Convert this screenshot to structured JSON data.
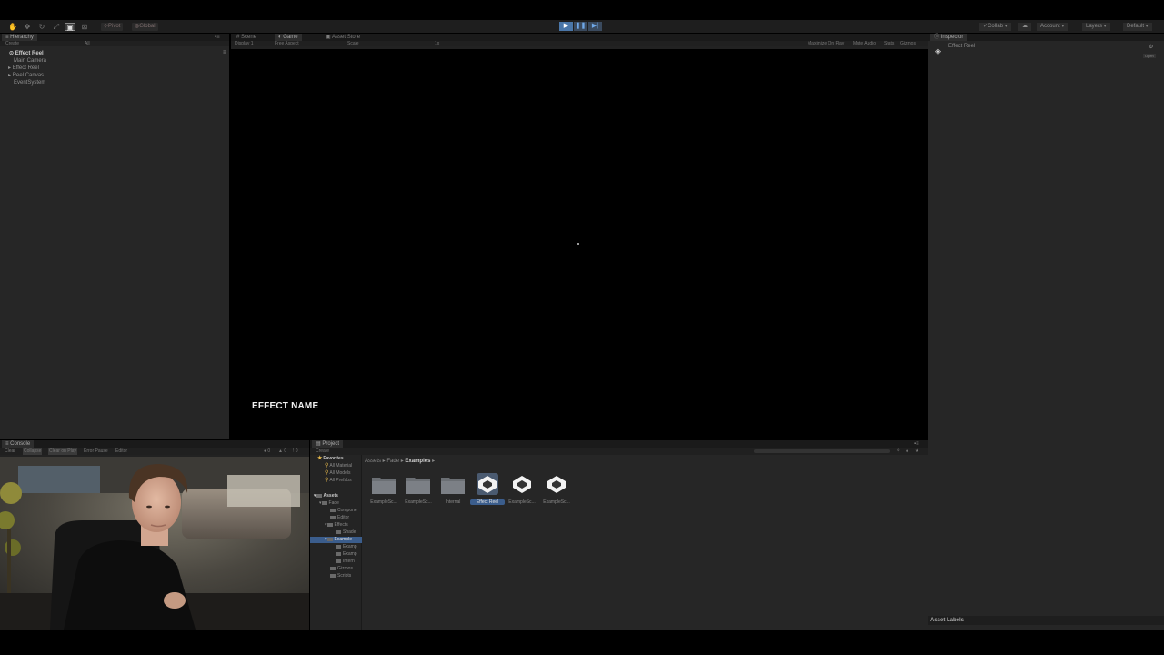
{
  "toolbar": {
    "pivot_label": "Pivot",
    "global_label": "Global",
    "collab_label": "Collab",
    "account_label": "Account",
    "layers_label": "Layers",
    "layout_label": "Default"
  },
  "hierarchy": {
    "tab_label": "Hierarchy",
    "create_label": "Create",
    "search_text": "All",
    "scene_name": "Effect Reel",
    "items": [
      "Main Camera",
      "Effect Reel",
      "Reel Canvas",
      "EventSystem"
    ]
  },
  "center": {
    "tabs": [
      "Scene",
      "Game",
      "Asset Store"
    ],
    "display_label": "Display 1",
    "aspect_label": "Free Aspect",
    "scale_label": "Scale",
    "scale_value": "1x",
    "toggles": [
      "Maximize On Play",
      "Mute Audio",
      "Stats",
      "Gizmos"
    ],
    "game_text": "EFFECT NAME"
  },
  "inspector": {
    "tab_label": "Inspector",
    "object_name": "Effect Reel",
    "open_label": "Open",
    "asset_labels_label": "Asset Labels"
  },
  "console": {
    "tab_label": "Console",
    "buttons": [
      "Clear",
      "Collapse",
      "Clear on Play",
      "Error Pause",
      "Editor"
    ],
    "counts": [
      "0",
      "0",
      "0"
    ]
  },
  "project": {
    "tab_label": "Project",
    "create_label": "Create",
    "favorites_label": "Favorites",
    "favorites": [
      "All Material",
      "All Models",
      "All Prefabs"
    ],
    "assets_label": "Assets",
    "tree": [
      "Fade",
      "Compone",
      "Editor",
      "Effects",
      "Shade",
      "Example",
      "Examp",
      "Examp",
      "Intern",
      "Gizmos",
      "Scripts"
    ],
    "breadcrumb": [
      "Assets",
      "Fade",
      "Examples"
    ],
    "assets": [
      {
        "label": "ExampleSc...",
        "kind": "folder"
      },
      {
        "label": "ExampleSc...",
        "kind": "folder"
      },
      {
        "label": "Internal",
        "kind": "folder"
      },
      {
        "label": "Effect Reel",
        "kind": "unity-scene"
      },
      {
        "label": "ExampleSc...",
        "kind": "unity-scene"
      },
      {
        "label": "ExampleSc...",
        "kind": "unity-scene"
      }
    ]
  },
  "colors": {
    "selection": "#3b5d8c",
    "play_active": "#4a76a8",
    "folder_star": "#e5b84a"
  }
}
